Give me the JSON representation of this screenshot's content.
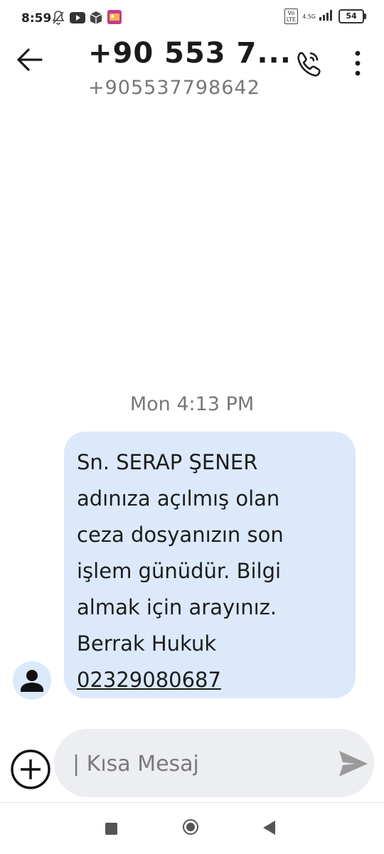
{
  "status_bar": {
    "time": "8:59",
    "volte": "Vo\nLTE",
    "network": "4.5G",
    "battery": "54",
    "icons": [
      "mute-notifications-icon",
      "youtube-icon",
      "box-icon",
      "photo-app-icon"
    ]
  },
  "header": {
    "title": "+90 553 7...",
    "subtitle": "+905537798642",
    "icons": [
      "back-arrow-icon",
      "call-icon",
      "more-vert-icon"
    ]
  },
  "conversation": {
    "timestamp": "Mon 4:13 PM",
    "message": {
      "text": "Sn. SERAP ŞENER\nadınıza açılmış olan\nceza dosyanızın son\nişlem günüdür. Bilgi\nalmak için arayınız.\nBerrak Hukuk",
      "phone_link": "02329080687"
    }
  },
  "composer": {
    "placeholder": "| Kısa Mesaj"
  },
  "colors": {
    "bubble": "#dbe9fb",
    "compose_bg": "#eceef1",
    "muted_text": "#777777"
  }
}
